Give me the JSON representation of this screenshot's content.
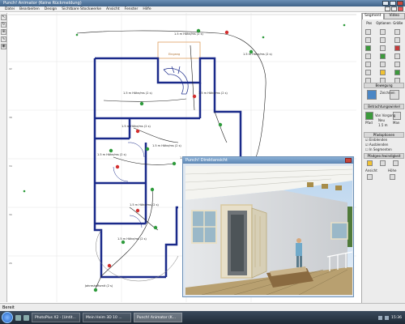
{
  "window": {
    "title": "Punch! Animator (Keine Rückmeldung)"
  },
  "menu": {
    "items": [
      "Datei",
      "Bearbeiten",
      "Design",
      "Sichtbare Stockwerke",
      "Ansicht",
      "Fenster",
      "Hilfe"
    ]
  },
  "canvas": {
    "labels": [
      "1.5 m Höhe/ms (2 s)",
      "1.5 m Höhe/ms (2 s)",
      "1.5 m Höhe/ms (2 s)",
      "1.5 m Höhe/ms (2 s)",
      "1.5 m Höhe/ms (2 s)",
      "1.5 m Höhe/ms (2 s)",
      "1.5 m Höhe/ms (2 s)",
      "1.5 m Höhe/ms (2 s)",
      "1.5 m Höhe/ms (2 s)",
      "1.5 m Höhe/ms (2 s)"
    ],
    "entry_label": "Eingang",
    "start_label": "Jahreshoftsmit (2 s)"
  },
  "right_panel": {
    "tabs": [
      "Segment",
      "Video"
    ],
    "cols": [
      "Pos",
      "Optionen",
      "Größe"
    ],
    "section_movement": "Bewegung",
    "section_drawing": "Zeichnen",
    "section_camera": "Betrachtungswinkel",
    "label_pfad": "Pfad",
    "label_man": "Man",
    "label_vorgang": "Von Vorgang",
    "label_neu": "Neu",
    "label_zeit": "1.5 m",
    "section_optics": "Pfadoptionen",
    "checkbox_1": "Einblenden",
    "checkbox_2": "Ausblenden",
    "checkbox_3": "In Segmenten",
    "section_speed": "Pfadgeschwindigkeit",
    "section_ansicht": "Ansicht",
    "section_hoehe": "Höhe"
  },
  "popup": {
    "title": "Punch! Direktansicht"
  },
  "status": {
    "text": "Bereit"
  },
  "taskbar": {
    "tasks": [
      "PhotoPlus X2 - [Untit...",
      "Mein Heim 3D 10 ...",
      "Punch! Animator (K..."
    ],
    "clock": "15:36"
  },
  "colors": {
    "wall": "#1a2a8a",
    "path_marker": "#2e9b3c",
    "path_marker_red": "#d32f2f",
    "accent": "#3f6288"
  }
}
